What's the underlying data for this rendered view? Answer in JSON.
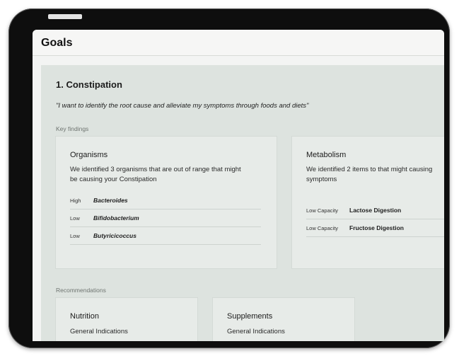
{
  "header": {
    "title": "Goals"
  },
  "goal": {
    "title": "1. Constipation",
    "quote": "\"I want to identify the root cause and alleviate my symptoms through foods and diets\""
  },
  "key_findings": {
    "label": "Key findings",
    "organisms": {
      "title": "Organisms",
      "description_line1": "We identified 3 organisms that are out of range that might",
      "description_line2": "be causing your Constipation",
      "rows": [
        {
          "level": "High",
          "name": "Bacteroides"
        },
        {
          "level": "Low",
          "name": "Bifidobacterium"
        },
        {
          "level": "Low",
          "name": "Butyricicoccus"
        }
      ]
    },
    "metabolism": {
      "title": "Metabolism",
      "description_line1": "We identified 2 items to that might causing",
      "description_line2": "symptoms",
      "rows": [
        {
          "level": "Low Capacity",
          "name": "Lactose Digestion"
        },
        {
          "level": "Low Capacity",
          "name": "Fructose Digestion"
        }
      ]
    }
  },
  "recommendations": {
    "label": "Recommendations",
    "nutrition": {
      "title": "Nutrition",
      "subtitle": "General Indications"
    },
    "supplements": {
      "title": "Supplements",
      "subtitle": "General Indications"
    }
  }
}
